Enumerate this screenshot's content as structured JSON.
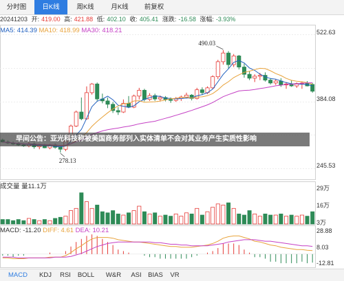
{
  "tabs": [
    {
      "label": "分时图",
      "active": false
    },
    {
      "label": "日K线",
      "active": true
    },
    {
      "label": "周K线",
      "active": false
    },
    {
      "label": "月K线",
      "active": false
    },
    {
      "label": "前复权",
      "active": false
    }
  ],
  "info": {
    "date": "20241203",
    "open_label": "开:",
    "open": "419.00",
    "high_label": "高:",
    "high": "421.88",
    "low_label": "低:",
    "low": "402.10",
    "close_label": "收:",
    "close": "405.41",
    "change_label": "涨跌:",
    "change": "-16.58",
    "pct_label": "涨幅:",
    "pct": "-3.93%"
  },
  "ma": {
    "ma5": "MA5: 414.39",
    "ma10": "MA10: 418.99",
    "ma30": "MA30: 418.21"
  },
  "volume": {
    "label": "成交量 量11.1万"
  },
  "macd": {
    "macd": "MACD: -11.20",
    "diff": "DIFF: 4.61",
    "dea": "DEA: 10.21"
  },
  "banner": "早间公告：亚光科技称被美国商务部列入实体清单不会对其业务产生实质性影响",
  "bottom_tabs": [
    {
      "label": "MACD",
      "active": true
    },
    {
      "label": "KDJ",
      "active": false
    },
    {
      "label": "RSI",
      "active": false
    },
    {
      "label": "BOLL",
      "active": false
    },
    {
      "label": "W&R",
      "active": false
    },
    {
      "label": "ASI",
      "active": false
    },
    {
      "label": "BIAS",
      "active": false
    },
    {
      "label": "VR",
      "active": false
    }
  ],
  "colors": {
    "up": "#e53935",
    "down": "#2e8b57",
    "ma5": "#1f5fbf",
    "ma10": "#e8a23a",
    "ma30": "#c43fc4",
    "diff": "#e8a23a",
    "dea": "#c43fc4",
    "accent": "#2f7de1"
  },
  "chart_data": {
    "type": "candlestick",
    "price_axis": {
      "labels": [
        "522.63",
        "384.08",
        "245.53"
      ],
      "range": [
        245.53,
        522.63
      ]
    },
    "annotations": [
      {
        "text": "490.03",
        "kind": "high"
      },
      {
        "text": "278.13",
        "kind": "low"
      }
    ],
    "candles": [
      [
        304,
        307,
        299,
        300
      ],
      [
        300,
        303,
        296,
        298
      ],
      [
        298,
        301,
        294,
        296
      ],
      [
        296,
        299,
        292,
        294
      ],
      [
        294,
        297,
        290,
        292
      ],
      [
        292,
        300,
        289,
        296
      ],
      [
        296,
        299,
        286,
        290
      ],
      [
        290,
        295,
        285,
        293
      ],
      [
        293,
        296,
        287,
        288
      ],
      [
        288,
        296,
        285,
        294
      ],
      [
        294,
        297,
        286,
        289
      ],
      [
        289,
        292,
        278,
        285
      ],
      [
        285,
        304,
        281,
        302
      ],
      [
        302,
        336,
        301,
        333
      ],
      [
        333,
        365,
        331,
        362
      ],
      [
        362,
        392,
        345,
        348
      ],
      [
        348,
        415,
        346,
        402
      ],
      [
        402,
        422,
        398,
        420
      ],
      [
        420,
        423,
        385,
        389
      ],
      [
        389,
        400,
        380,
        385
      ],
      [
        385,
        392,
        370,
        378
      ],
      [
        378,
        383,
        360,
        365
      ],
      [
        365,
        372,
        356,
        362
      ],
      [
        362,
        388,
        360,
        380
      ],
      [
        380,
        395,
        370,
        372
      ],
      [
        372,
        398,
        370,
        395
      ],
      [
        395,
        412,
        388,
        407
      ],
      [
        407,
        410,
        384,
        388
      ],
      [
        388,
        401,
        385,
        396
      ],
      [
        396,
        400,
        385,
        389
      ],
      [
        389,
        396,
        384,
        392
      ],
      [
        392,
        395,
        384,
        388
      ],
      [
        388,
        392,
        381,
        386
      ],
      [
        386,
        393,
        383,
        390
      ],
      [
        390,
        396,
        385,
        393
      ],
      [
        393,
        402,
        390,
        397
      ],
      [
        397,
        399,
        386,
        390
      ],
      [
        390,
        412,
        388,
        408
      ],
      [
        408,
        413,
        397,
        402
      ],
      [
        402,
        415,
        399,
        412
      ],
      [
        412,
        438,
        410,
        435
      ],
      [
        435,
        470,
        430,
        466
      ],
      [
        466,
        490,
        460,
        484
      ],
      [
        484,
        488,
        452,
        460
      ],
      [
        460,
        482,
        455,
        478
      ],
      [
        478,
        480,
        450,
        455
      ],
      [
        455,
        462,
        433,
        440
      ],
      [
        440,
        446,
        428,
        432
      ],
      [
        432,
        440,
        424,
        436
      ],
      [
        436,
        443,
        428,
        438
      ],
      [
        438,
        444,
        425,
        428
      ],
      [
        428,
        432,
        419,
        422
      ],
      [
        422,
        430,
        418,
        426
      ],
      [
        426,
        432,
        414,
        418
      ],
      [
        418,
        424,
        410,
        420
      ],
      [
        420,
        427,
        414,
        416
      ],
      [
        416,
        423,
        412,
        421
      ],
      [
        421,
        425,
        410,
        422
      ],
      [
        422,
        426,
        415,
        416
      ],
      [
        419,
        422,
        402,
        405
      ]
    ],
    "volume_axis": {
      "labels": [
        "29万",
        "16万",
        "3万"
      ]
    },
    "volumes": [
      4,
      4,
      3,
      4,
      3,
      5,
      4,
      3,
      4,
      3,
      5,
      6,
      7,
      12,
      14,
      28,
      20,
      14,
      17,
      11,
      10,
      12,
      9,
      8,
      10,
      12,
      16,
      11,
      9,
      10,
      7,
      8,
      7,
      9,
      7,
      10,
      9,
      14,
      8,
      11,
      15,
      18,
      17,
      19,
      14,
      9,
      8,
      12,
      9,
      7,
      9,
      8,
      8,
      9,
      7,
      8,
      7,
      8,
      7,
      11
    ],
    "macd_axis": {
      "labels": [
        "28.88",
        "8.03",
        "-12.81"
      ]
    },
    "diff": [
      -5,
      -5,
      -6,
      -6,
      -6,
      -5,
      -5,
      -5,
      -5,
      -4,
      -4,
      -4,
      -2,
      2,
      7,
      11,
      16,
      20,
      22,
      22,
      22,
      21,
      19,
      18,
      17,
      16,
      16,
      15,
      14,
      13,
      12,
      11,
      10,
      10,
      9,
      9,
      9,
      10,
      11,
      12,
      14,
      17,
      21,
      23,
      24,
      24,
      22,
      20,
      17,
      16,
      14,
      12,
      11,
      9,
      8,
      7,
      6,
      6,
      5,
      4.61
    ],
    "dea": [
      -4,
      -4,
      -4,
      -5,
      -5,
      -5,
      -5,
      -5,
      -5,
      -5,
      -4,
      -4,
      -4,
      -3,
      -1,
      1,
      4,
      7,
      10,
      12,
      14,
      15,
      16,
      16,
      16,
      16,
      16,
      16,
      16,
      15,
      15,
      14,
      13,
      13,
      12,
      12,
      11,
      11,
      11,
      11,
      12,
      13,
      14,
      16,
      17,
      18,
      19,
      19,
      19,
      18,
      17,
      17,
      16,
      15,
      14,
      13,
      12,
      11,
      11,
      10.21
    ]
  }
}
